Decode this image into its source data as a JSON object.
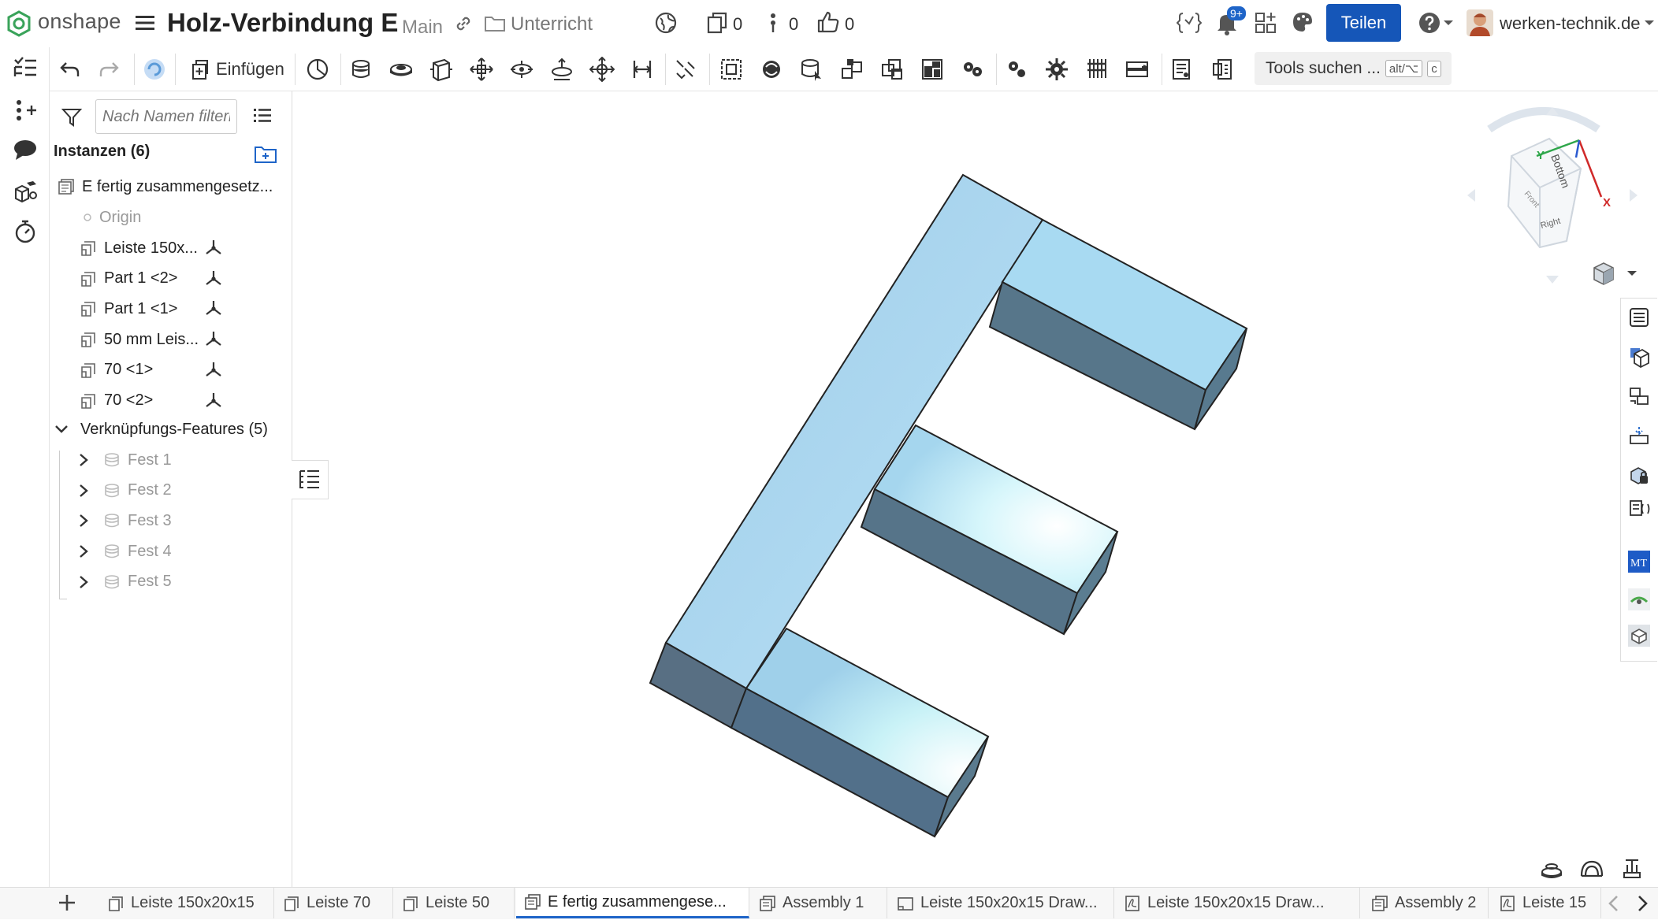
{
  "app": {
    "logo_text": "onshape"
  },
  "document": {
    "title": "Holz-Verbindung E",
    "branch": "Main",
    "folder": "Unterricht",
    "copies": "0",
    "versions": "0",
    "likes": "0"
  },
  "header": {
    "notifications_badge": "9+",
    "share_label": "Teilen",
    "user_name": "werken-technik.de"
  },
  "toolbar": {
    "insert_label": "Einfügen",
    "search_label": "Tools suchen ...",
    "search_shortcut_mod": "alt/⌥",
    "search_shortcut_key": "c",
    "icons": [
      "undo-icon",
      "redo-icon",
      "regen-icon",
      "insert-icon",
      "cycle-icon",
      "fastened-mate-icon",
      "revolute-mate-icon",
      "slider-mate-icon",
      "planar-mate-icon",
      "cylindrical-mate-icon",
      "pin-slot-mate-icon",
      "ball-mate-icon",
      "parallel-mate-icon",
      "tangent-mate-icon",
      "group-icon",
      "replicate-icon",
      "mate-connector-icon",
      "linear-pattern-icon",
      "circular-pattern-icon",
      "explode-icon",
      "gear-relation-icon",
      "rack-pinion-icon",
      "screw-relation-icon",
      "linear-relation-icon",
      "measure-icon",
      "section-view-icon"
    ]
  },
  "panel": {
    "filter_placeholder": "Nach Namen filtern",
    "instances_header": "Instanzen (6)",
    "assembly_name": "E fertig zusammengesetz...",
    "origin": "Origin",
    "instances": [
      "Leiste 150x...",
      "Part 1 <2>",
      "Part 1 <1>",
      "50 mm Leis...",
      "70 <1>",
      "70 <2>"
    ],
    "mates_header": "Verknüpfungs-Features (5)",
    "mates": [
      "Fest 1",
      "Fest 2",
      "Fest 3",
      "Fest 4",
      "Fest 5"
    ]
  },
  "viewcube": {
    "face_top": "Bottom",
    "face_right": "Right",
    "face_front": "Front",
    "axis_x": "X",
    "axis_y": "Y"
  },
  "tabs": [
    {
      "label": "Leiste 150x20x15",
      "icon": "part-studio-icon"
    },
    {
      "label": "Leiste 70",
      "icon": "part-studio-icon"
    },
    {
      "label": "Leiste 50",
      "icon": "part-studio-icon"
    },
    {
      "label": "E fertig zusammengese...",
      "icon": "assembly-icon",
      "active": true
    },
    {
      "label": "Assembly 1",
      "icon": "assembly-icon"
    },
    {
      "label": "Leiste 150x20x15 Draw...",
      "icon": "drawing-icon"
    },
    {
      "label": "Leiste 150x20x15 Draw...",
      "icon": "pdf-icon"
    },
    {
      "label": "Assembly 2",
      "icon": "assembly-icon"
    },
    {
      "label": "Leiste 15",
      "icon": "pdf-icon"
    }
  ],
  "colors": {
    "accent": "#1556b8",
    "model_top": "#a9d6ef",
    "model_side": "#58768b"
  }
}
